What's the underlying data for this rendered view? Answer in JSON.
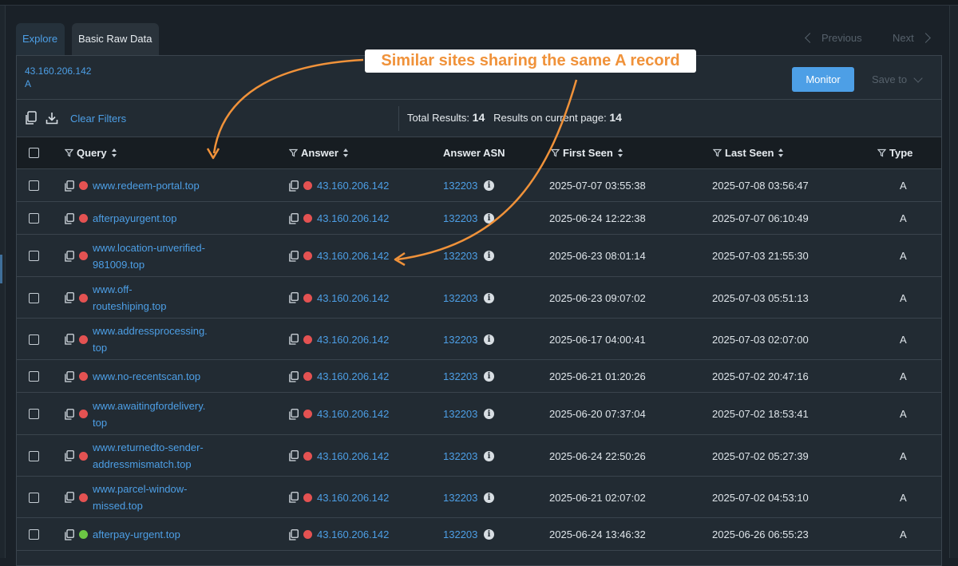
{
  "tabs": [
    {
      "label": "Explore",
      "active": true
    },
    {
      "label": "Basic Raw Data",
      "active": false
    }
  ],
  "pagination": {
    "previous": "Previous",
    "next": "Next"
  },
  "header": {
    "ip": "43.160.206.142",
    "record_type": "A"
  },
  "actions": {
    "monitor": "Monitor",
    "save_to": "Save to"
  },
  "toolbar": {
    "clear_filters": "Clear Filters",
    "total_label": "Total Results:",
    "total_value": "14",
    "page_label": "Results on current page:",
    "page_value": "14"
  },
  "columns": {
    "query": "Query",
    "answer": "Answer",
    "answer_asn": "Answer ASN",
    "first_seen": "First Seen",
    "last_seen": "Last Seen",
    "type": "Type"
  },
  "rows": [
    {
      "query": [
        "www.redeem-portal.top"
      ],
      "status": "red",
      "answer": "43.160.206.142",
      "asn": "132203",
      "first_seen": "2025-07-07 03:55:38",
      "last_seen": "2025-07-08 03:56:47",
      "type": "A"
    },
    {
      "query": [
        "afterpayurgent.top"
      ],
      "status": "red",
      "answer": "43.160.206.142",
      "asn": "132203",
      "first_seen": "2025-06-24 12:22:38",
      "last_seen": "2025-07-07 06:10:49",
      "type": "A"
    },
    {
      "query": [
        "www.location-unverified-",
        "981009.top"
      ],
      "status": "red",
      "answer": "43.160.206.142",
      "asn": "132203",
      "first_seen": "2025-06-23 08:01:14",
      "last_seen": "2025-07-03 21:55:30",
      "type": "A"
    },
    {
      "query": [
        "www.off-",
        "routeshiping.top"
      ],
      "status": "red",
      "answer": "43.160.206.142",
      "asn": "132203",
      "first_seen": "2025-06-23 09:07:02",
      "last_seen": "2025-07-03 05:51:13",
      "type": "A"
    },
    {
      "query": [
        "www.addressprocessing.",
        "top"
      ],
      "status": "red",
      "answer": "43.160.206.142",
      "asn": "132203",
      "first_seen": "2025-06-17 04:00:41",
      "last_seen": "2025-07-03 02:07:00",
      "type": "A"
    },
    {
      "query": [
        "www.no-recentscan.top"
      ],
      "status": "red",
      "answer": "43.160.206.142",
      "asn": "132203",
      "first_seen": "2025-06-21 01:20:26",
      "last_seen": "2025-07-02 20:47:16",
      "type": "A"
    },
    {
      "query": [
        "www.awaitingfordelivery.",
        "top"
      ],
      "status": "red",
      "answer": "43.160.206.142",
      "asn": "132203",
      "first_seen": "2025-06-20 07:37:04",
      "last_seen": "2025-07-02 18:53:41",
      "type": "A"
    },
    {
      "query": [
        "www.returnedto-sender-",
        "addressmismatch.top"
      ],
      "status": "red",
      "answer": "43.160.206.142",
      "asn": "132203",
      "first_seen": "2025-06-24 22:50:26",
      "last_seen": "2025-07-02 05:27:39",
      "type": "A"
    },
    {
      "query": [
        "www.parcel-window-",
        "missed.top"
      ],
      "status": "red",
      "answer": "43.160.206.142",
      "asn": "132203",
      "first_seen": "2025-06-21 02:07:02",
      "last_seen": "2025-07-02 04:53:10",
      "type": "A"
    },
    {
      "query": [
        "afterpay-urgent.top"
      ],
      "status": "green",
      "answer": "43.160.206.142",
      "asn": "132203",
      "first_seen": "2025-06-24 13:46:32",
      "last_seen": "2025-06-26 06:55:23",
      "type": "A"
    }
  ],
  "annotation": {
    "text": "Similar sites sharing the same A record"
  },
  "colors": {
    "accent": "#4d9fe6",
    "status_red": "#e45252",
    "status_green": "#6cc644",
    "annotation_orange": "#f0923a"
  }
}
